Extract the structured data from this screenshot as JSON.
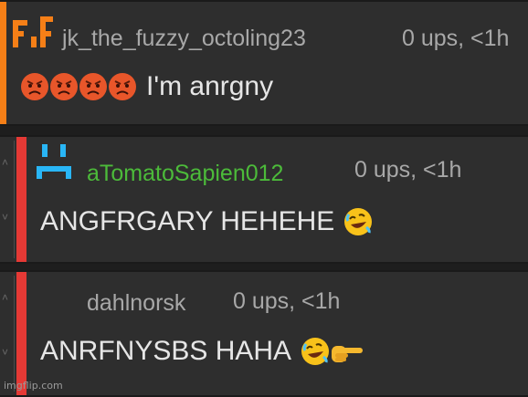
{
  "comments": [
    {
      "username": "jk_the_fuzzy_octoling23",
      "meta": "0 ups, <1h",
      "text": "I'm anrgny",
      "emojis": [
        "pouting-face",
        "pouting-face",
        "pouting-face",
        "pouting-face"
      ],
      "username_color": "#a8a8a8",
      "bar_color": "#f57f17",
      "avatar": "orange-pixel-avatar"
    },
    {
      "username": "aTomatoSapien012",
      "meta": "0 ups, <1h",
      "text": "ANGFRGARY HEHEHE",
      "emojis": [
        "rolling-on-floor-laughing"
      ],
      "username_color": "#4cbb3a",
      "bar_color": "#e53935",
      "avatar": "cyan-frown-avatar"
    },
    {
      "username": "dahlnorsk",
      "meta": "0 ups, <1h",
      "text": "ANRFNYSBS HAHA",
      "emojis": [
        "rolling-on-floor-laughing",
        "backhand-index-pointing-right"
      ],
      "username_color": "#a8a8a8",
      "bar_color": "#e53935"
    }
  ],
  "watermark": "imgflip.com"
}
